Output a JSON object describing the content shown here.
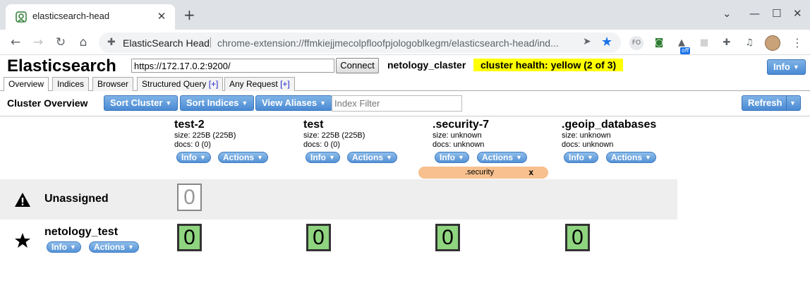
{
  "browser": {
    "tab_title": "elasticsearch-head",
    "site_label": "ElasticSearch Head",
    "url": "chrome-extension://ffmkiejjmecolpfloofpjologoblkegm/elasticsearch-head/ind...",
    "extension_badge": "off",
    "ext_fo": "FO",
    "accent": "#1a73e8"
  },
  "header": {
    "brand": "Elasticsearch",
    "connect_url": "https://172.17.0.2:9200/",
    "connect_label": "Connect",
    "cluster_name": "netology_claster",
    "health": "cluster health: yellow (2 of 3)",
    "health_color": "#ffff00",
    "info_label": "Info"
  },
  "tabs": [
    {
      "label": "Overview",
      "plus": ""
    },
    {
      "label": "Indices",
      "plus": ""
    },
    {
      "label": "Browser",
      "plus": ""
    },
    {
      "label": "Structured Query",
      "plus": "[+]"
    },
    {
      "label": "Any Request",
      "plus": "[+]"
    }
  ],
  "overview": {
    "title": "Cluster Overview",
    "sort_cluster": "Sort Cluster",
    "sort_indices": "Sort Indices",
    "view_aliases": "View Aliases",
    "filter_placeholder": "Index Filter",
    "refresh": "Refresh"
  },
  "indices": [
    {
      "name": "test-2",
      "size": "size: 225B (225B)",
      "docs": "docs: 0 (0)",
      "info": "Info",
      "actions": "Actions"
    },
    {
      "name": "test",
      "size": "size: 225B (225B)",
      "docs": "docs: 0 (0)",
      "info": "Info",
      "actions": "Actions"
    },
    {
      "name": ".security-7",
      "size": "size: unknown",
      "docs": "docs: unknown",
      "info": "Info",
      "actions": "Actions"
    },
    {
      "name": ".geoip_databases",
      "size": "size: unknown",
      "docs": "docs: unknown",
      "info": "Info",
      "actions": "Actions"
    }
  ],
  "alias": {
    "name": ".security",
    "close": "x"
  },
  "unassigned": {
    "label": "Unassigned",
    "shards": [
      "0"
    ]
  },
  "node": {
    "name": "netology_test",
    "info": "Info",
    "actions": "Actions",
    "shards": [
      "0",
      "0",
      "0",
      "0"
    ]
  }
}
